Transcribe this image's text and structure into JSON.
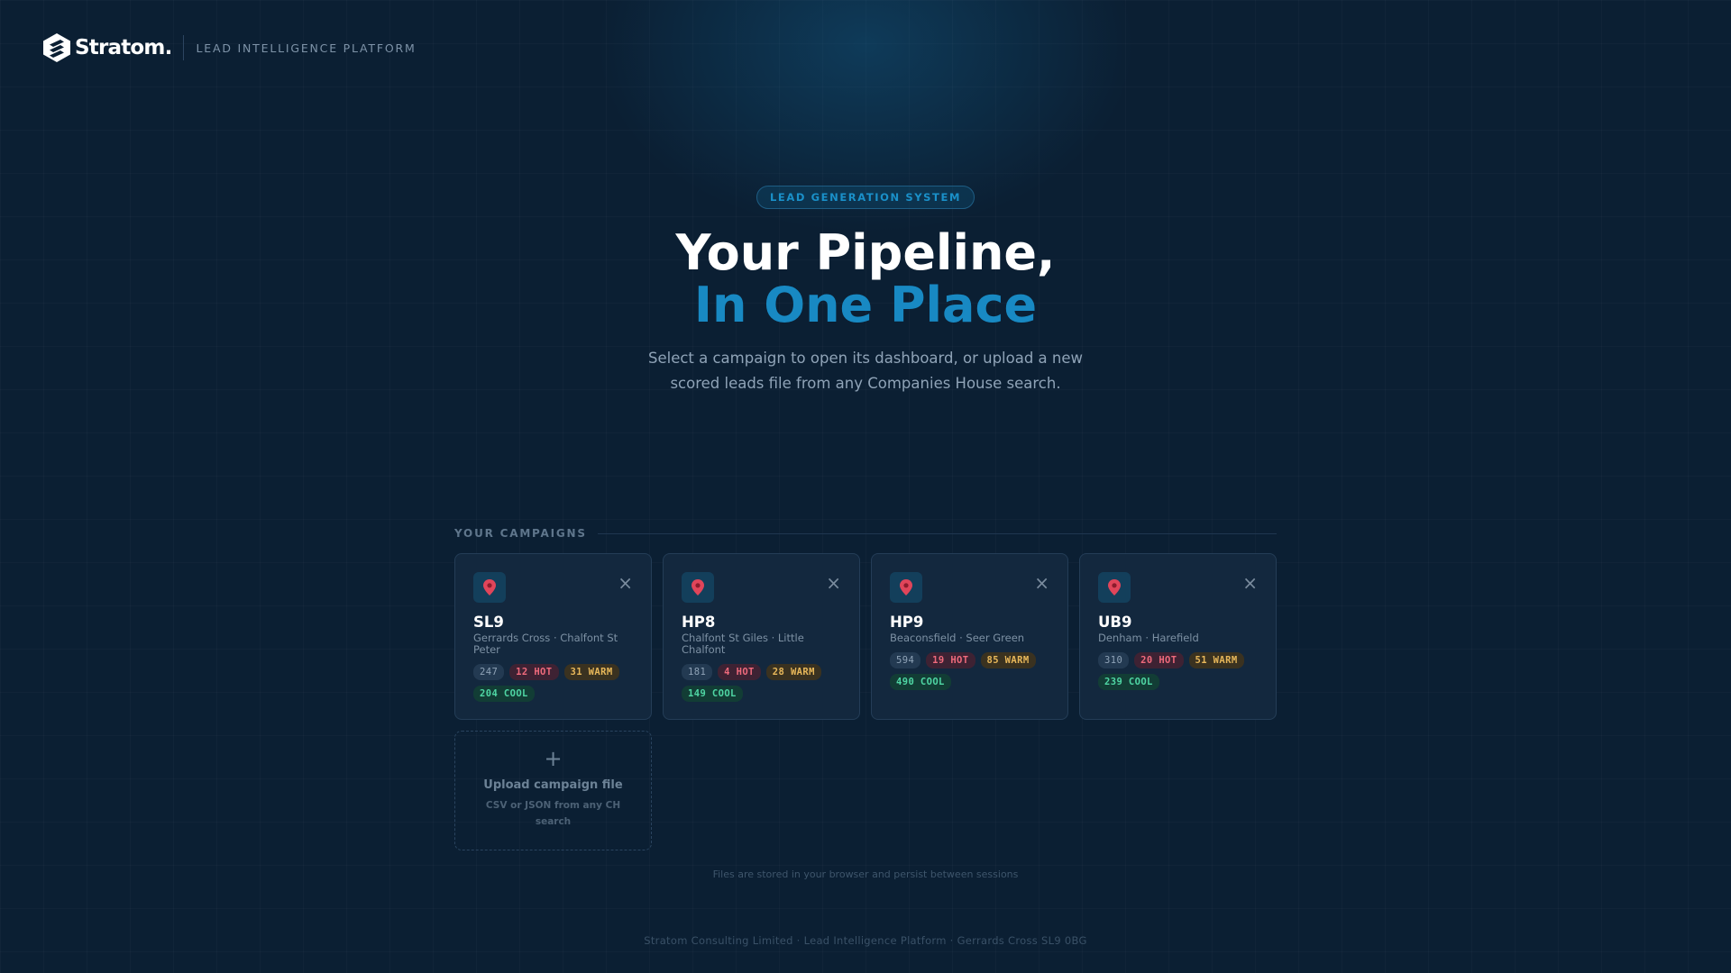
{
  "header": {
    "logo_text": "Stratom.",
    "subtitle": "LEAD INTELLIGENCE PLATFORM"
  },
  "hero": {
    "pill": "LEAD GENERATION SYSTEM",
    "title_line1": "Your Pipeline,",
    "title_line2": "In One Place",
    "description": "Select a campaign to open its dashboard, or upload a new scored leads file from any Companies House search."
  },
  "campaigns": {
    "section_label": "YOUR CAMPAIGNS",
    "items": [
      {
        "code": "SL9",
        "areas": "Gerrards Cross · Chalfont St Peter",
        "total": "247",
        "hot": "12 HOT",
        "warm": "31 WARM",
        "cool": "204 COOL"
      },
      {
        "code": "HP8",
        "areas": "Chalfont St Giles · Little Chalfont",
        "total": "181",
        "hot": "4 HOT",
        "warm": "28 WARM",
        "cool": "149 COOL"
      },
      {
        "code": "HP9",
        "areas": "Beaconsfield · Seer Green",
        "total": "594",
        "hot": "19 HOT",
        "warm": "85 WARM",
        "cool": "490 COOL"
      },
      {
        "code": "UB9",
        "areas": "Denham · Harefield",
        "total": "310",
        "hot": "20 HOT",
        "warm": "51 WARM",
        "cool": "239 COOL"
      }
    ],
    "upload": {
      "plus": "+",
      "title": "Upload campaign file",
      "subtitle": "CSV or JSON from any CH search"
    }
  },
  "storage_note": "Files are stored in your browser and persist between sessions",
  "footer": "Stratom Consulting Limited · Lead Intelligence Platform · Gerrards Cross SL9 0BG",
  "icons": {
    "logo": "stratom-logo-icon",
    "pin": "map-pin-icon",
    "close": "close-icon",
    "upload": "plus-icon"
  },
  "colors": {
    "background": "#0b1f33",
    "accent": "#1889c3",
    "hot": "#ef6a7c",
    "warm": "#e8b85a",
    "cool": "#4fd6a4"
  }
}
